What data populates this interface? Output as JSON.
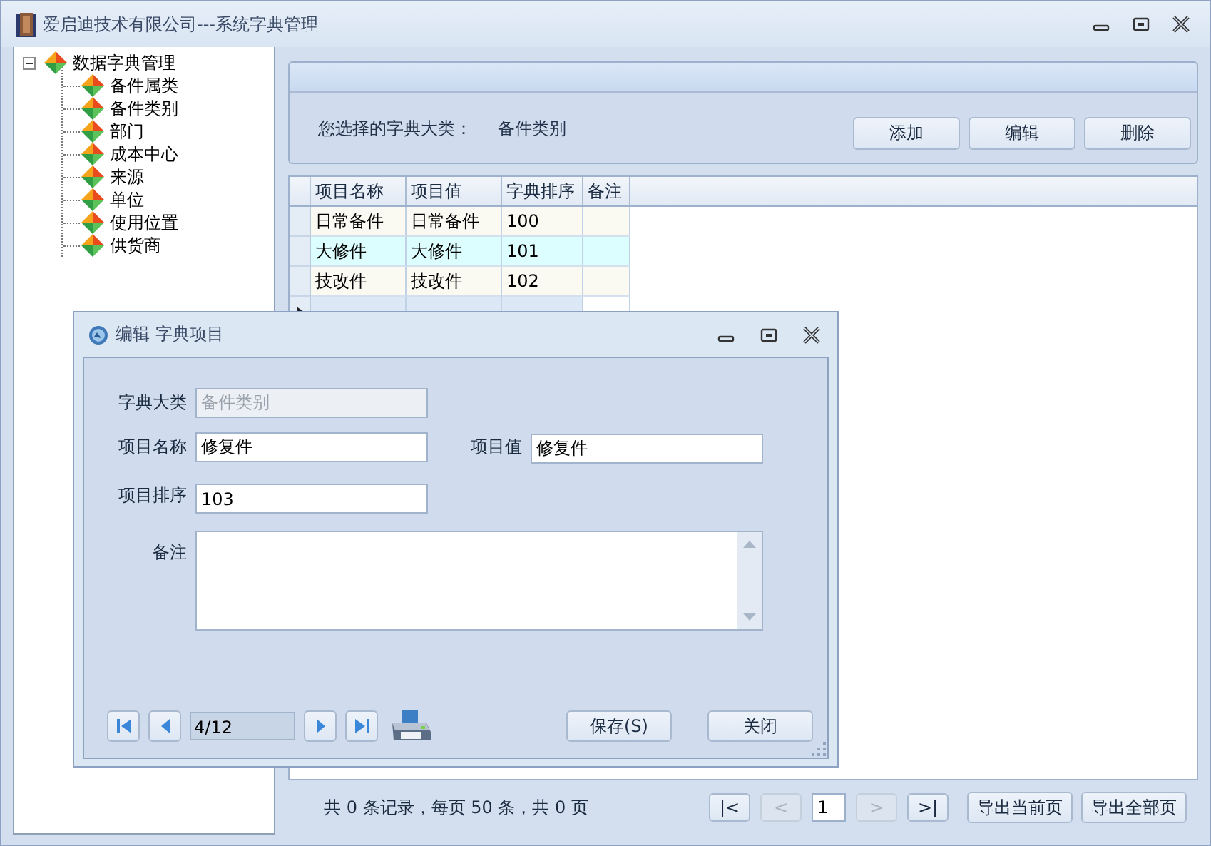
{
  "window": {
    "title": "爱启迪技术有限公司---系统字典管理"
  },
  "tree": {
    "label": "数据字典管理",
    "expanded": true,
    "children": [
      {
        "label": "备件属类"
      },
      {
        "label": "备件类别"
      },
      {
        "label": "部门"
      },
      {
        "label": "成本中心"
      },
      {
        "label": "来源"
      },
      {
        "label": "单位"
      },
      {
        "label": "使用位置"
      },
      {
        "label": "供货商"
      }
    ]
  },
  "selection_panel": {
    "label": "您选择的字典大类：",
    "value": "备件类别",
    "buttons": [
      "添加",
      "编辑",
      "删除"
    ]
  },
  "table": {
    "columns": [
      "项目名称",
      "项目值",
      "字典排序",
      "备注"
    ],
    "rows": [
      {
        "name": "日常备件",
        "value": "日常备件",
        "order": "100",
        "current": false
      },
      {
        "name": "大修件",
        "value": "大修件",
        "order": "101",
        "current": false
      },
      {
        "name": "技改件",
        "value": "技改件",
        "order": "102",
        "current": false
      },
      {
        "current": true
      }
    ]
  },
  "pager": {
    "summary": "共 0 条记录，每页 50 条，共 0 页",
    "page": "1",
    "buttons": [
      {
        "label": "|<",
        "disabled": false
      },
      {
        "label": "<",
        "disabled": true
      },
      {
        "label": ">",
        "disabled": true
      },
      {
        "label": ">|",
        "disabled": false
      }
    ],
    "export_buttons": [
      "导出当前页",
      "导出全部页"
    ]
  },
  "dialog": {
    "title": "编辑 字典项目",
    "fields": [
      {
        "label": "字典大类",
        "value": "备件类别",
        "disabled": true
      },
      {
        "label": "项目名称",
        "value": "修复件",
        "disabled": false
      },
      {
        "label": "项目值",
        "value": "修复件",
        "disabled": false
      },
      {
        "label": "项目排序",
        "value": "103",
        "disabled": false
      }
    ],
    "notes_label": "备注",
    "record": "4/12",
    "buttons": [
      "保存(S)",
      "关闭"
    ]
  }
}
